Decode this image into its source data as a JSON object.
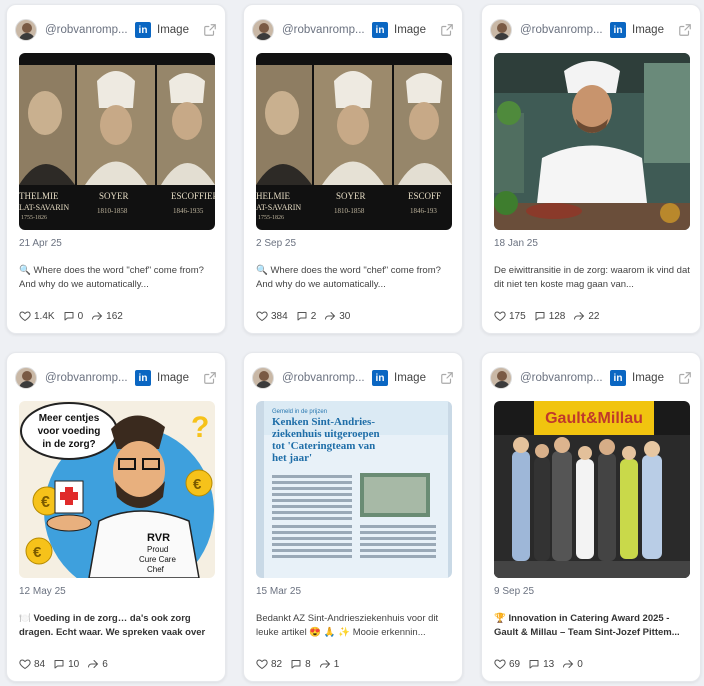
{
  "cards": [
    {
      "handle": "@robvanromp...",
      "network_badge": "in",
      "type": "Image",
      "image_desc": "historic-chefs-portrait",
      "image_labels": [
        "THELMIE",
        "LAT-SAVARIN",
        "1755-1826",
        "SOYER",
        "1810-1858",
        "ESCOFFIER",
        "1846-1935"
      ],
      "date": "21 Apr 25",
      "text": "🔍 Where does the word \"chef\" come from? And why do we automatically...",
      "likes": "1.4K",
      "comments": "0",
      "shares": "162"
    },
    {
      "handle": "@robvanromp...",
      "network_badge": "in",
      "type": "Image",
      "image_desc": "historic-chefs-portrait",
      "image_labels": [
        "HELMIE",
        "AT-SAVARIN",
        "1755-1826",
        "SOYER",
        "1810-1858",
        "ESCOFF",
        "1846-193"
      ],
      "date": "2 Sep 25",
      "text": "🔍 Where does the word \"chef\" come from? And why do we automatically...",
      "likes": "384",
      "comments": "2",
      "shares": "30"
    },
    {
      "handle": "@robvanromp...",
      "network_badge": "in",
      "type": "Image",
      "image_desc": "chef-in-kitchen",
      "date": "18 Jan 25",
      "text": "De eiwittransitie in de zorg: waarom ik vind dat dit niet ten koste mag gaan van...",
      "likes": "175",
      "comments": "128",
      "shares": "22"
    },
    {
      "handle": "@robvanromp...",
      "network_badge": "in",
      "type": "Image",
      "image_desc": "cartoon-chef",
      "image_labels": [
        "Meer centjes",
        "voor voeding",
        "in de zorg?",
        "RVR",
        "Proud",
        "Cure Care",
        "Chef"
      ],
      "date": "12 May 25",
      "text": "🍽️ Voeding in de zorg… da's ook zorg dragen. Echt waar. We spreken vaak over warme...",
      "bold": true,
      "likes": "84",
      "comments": "10",
      "shares": "6"
    },
    {
      "handle": "@robvanromp...",
      "network_badge": "in",
      "type": "Image",
      "image_desc": "magazine-article",
      "image_labels": [
        "Gemeld in de prijzen",
        "Kenken Sint-Andries-",
        "ziekenhuis uitgeroepen",
        "tot 'Cateringteam van",
        "het jaar'"
      ],
      "date": "15 Mar 25",
      "text": "Bedankt AZ Sint-Andriesziekenhuis voor dit leuke artikel 😍 🙏 ✨ Mooie erkennin...",
      "likes": "82",
      "comments": "8",
      "shares": "1"
    },
    {
      "handle": "@robvanromp...",
      "network_badge": "in",
      "type": "Image",
      "image_desc": "award-group-photo",
      "image_labels": [
        "Gault&Millau"
      ],
      "date": "9 Sep 25",
      "text": "🏆 Innovation in Catering Award 2025 - Gault & Millau – Team Sint-Jozef Pittem...",
      "bold": true,
      "likes": "69",
      "comments": "13",
      "shares": "0"
    }
  ]
}
